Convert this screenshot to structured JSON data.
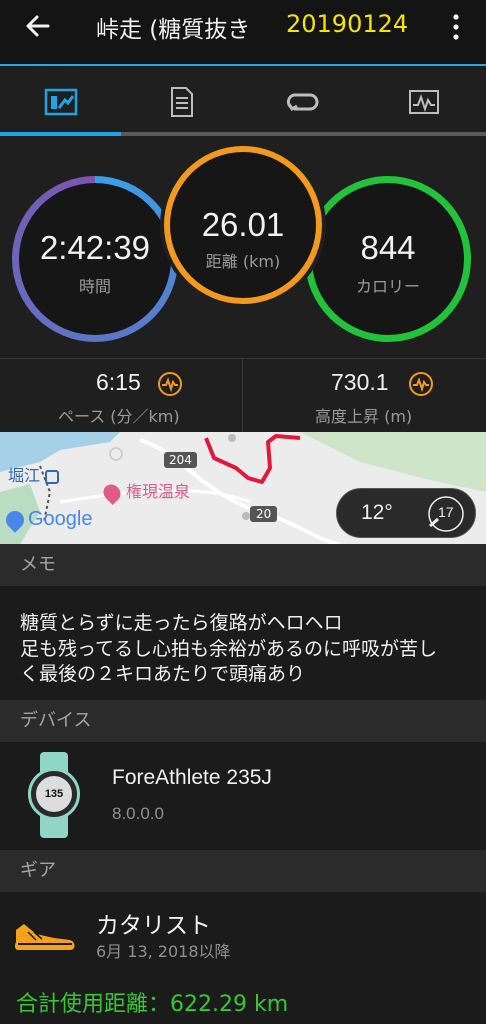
{
  "header": {
    "title": "峠走 (糖質抜き",
    "date": "20190124"
  },
  "tabs": [
    {
      "icon": "summary-chart-icon",
      "active": true
    },
    {
      "icon": "details-list-icon",
      "active": false
    },
    {
      "icon": "laps-loop-icon",
      "active": false
    },
    {
      "icon": "graph-icon",
      "active": false
    }
  ],
  "summary": {
    "time": {
      "value": "2:42:39",
      "label": "時間",
      "color": "#3aa0e8"
    },
    "distance": {
      "value": "26.01",
      "label": "距離 (km)",
      "color": "#f39a1e"
    },
    "calories": {
      "value": "844",
      "label": "カロリー",
      "color": "#22c23a"
    }
  },
  "stats": {
    "pace": {
      "value": "6:15",
      "label": "ペース (分／km)"
    },
    "elevation": {
      "value": "730.1",
      "label": "高度上昇 (m)"
    }
  },
  "map": {
    "place_horie": "堀江",
    "place_onsen": "権現温泉",
    "road_204": "204",
    "road_20": "20",
    "google": "Google",
    "weather_temp": "12°",
    "wind_speed": "17",
    "route_color": "#e0193c"
  },
  "memo": {
    "header": "メモ",
    "lines": [
      "糖質とらずに走ったら復路がヘロヘロ",
      "足も残ってるし心拍も余裕があるのに呼吸が苦し",
      "く最後の２キロあたりで頭痛あり"
    ]
  },
  "device": {
    "header": "デバイス",
    "name": "ForeAthlete 235J",
    "version": "8.0.0.0",
    "watch_display": "135"
  },
  "gear": {
    "header": "ギア",
    "name": "カタリスト",
    "since": "6月 13, 2018以降",
    "total": "合計使用距離：622.29 km"
  },
  "colors": {
    "accent": "#1fa4e3",
    "date": "#f5e600",
    "total": "#39c635"
  }
}
